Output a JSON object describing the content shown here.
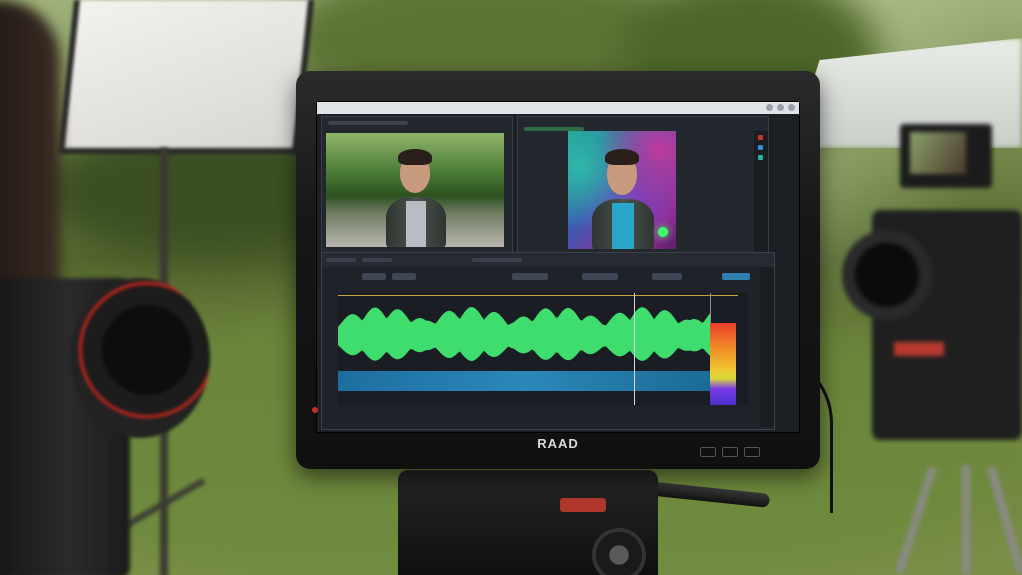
{
  "monitor": {
    "brand": "RAAD",
    "app": {
      "source_panel_label": "",
      "program_panel_label": ""
    }
  },
  "colors": {
    "waveform": "#3fdc6e",
    "meter_top": "#ea3d2b",
    "meter_bottom": "#4b2fd0",
    "timeline_band": "#2a88b8",
    "accent_green": "#6fd17e"
  }
}
